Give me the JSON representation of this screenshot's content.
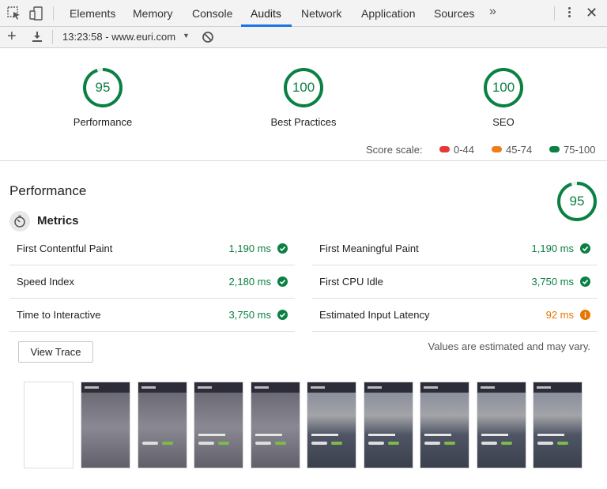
{
  "devtools": {
    "tabs": [
      "Elements",
      "Memory",
      "Console",
      "Audits",
      "Network",
      "Application",
      "Sources"
    ],
    "active_tab": "Audits",
    "more_label": "»",
    "close_label": "✕"
  },
  "toolbar": {
    "session": "13:23:58 - www.euri.com",
    "caret": "▼"
  },
  "summary": {
    "gauges": [
      {
        "label": "Performance",
        "score": "95",
        "value": 95
      },
      {
        "label": "Best Practices",
        "score": "100",
        "value": 100
      },
      {
        "label": "SEO",
        "score": "100",
        "value": 100
      }
    ]
  },
  "score_scale": {
    "label": "Score scale:",
    "ranges": [
      {
        "text": "0-44",
        "color": "#e53935"
      },
      {
        "text": "45-74",
        "color": "#ef7d1a"
      },
      {
        "text": "75-100",
        "color": "#0b8043"
      }
    ]
  },
  "performance": {
    "title": "Performance",
    "score": "95",
    "value": 95,
    "metrics_title": "Metrics",
    "metrics": [
      {
        "name": "First Contentful Paint",
        "value": "1,190 ms",
        "status": "pass"
      },
      {
        "name": "First Meaningful Paint",
        "value": "1,190 ms",
        "status": "pass"
      },
      {
        "name": "Speed Index",
        "value": "2,180 ms",
        "status": "pass"
      },
      {
        "name": "First CPU Idle",
        "value": "3,750 ms",
        "status": "pass"
      },
      {
        "name": "Time to Interactive",
        "value": "3,750 ms",
        "status": "pass"
      },
      {
        "name": "Estimated Input Latency",
        "value": "92 ms",
        "status": "average"
      }
    ],
    "view_trace_label": "View Trace",
    "disclaimer": "Values are estimated and may vary."
  },
  "colors": {
    "pass": "#0b8043",
    "average": "#e67700",
    "accent": "#1a73e8"
  },
  "filmstrip": {
    "frames": [
      "blank",
      "blur",
      "blur-button",
      "blur-button",
      "blur-button",
      "photo",
      "photo",
      "photo",
      "photo",
      "photo"
    ]
  }
}
